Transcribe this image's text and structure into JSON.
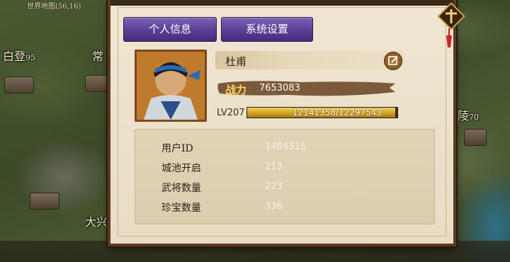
{
  "map": {
    "coordinates": "世界地图(56,16)",
    "labels": [
      {
        "name": "白登",
        "num": "95"
      },
      {
        "name": "常",
        "num": ""
      },
      {
        "name": "陵",
        "num": "70"
      },
      {
        "name": "大兴",
        "num": ""
      }
    ]
  },
  "tabs": {
    "personal": "个人信息",
    "system": "系统设置"
  },
  "player": {
    "name": "杜甫",
    "power_label": "战力",
    "power": "7653083",
    "level": "LV207",
    "xp_text": "12141358/12297543",
    "xp_fraction": 0.987
  },
  "stats": [
    {
      "label": "用户ID",
      "value": "1484315"
    },
    {
      "label": "城池开启",
      "value": "213"
    },
    {
      "label": "武将数量",
      "value": "223"
    },
    {
      "label": "珍宝数量",
      "value": "336"
    }
  ],
  "icons": {
    "edit": "edit-icon",
    "close": "close-icon",
    "avatar": "hero-portrait"
  },
  "colors": {
    "tab": "#5a3f95",
    "xp": "#d2a222",
    "power": "#ffd35a",
    "frame": "#5a3b22"
  }
}
